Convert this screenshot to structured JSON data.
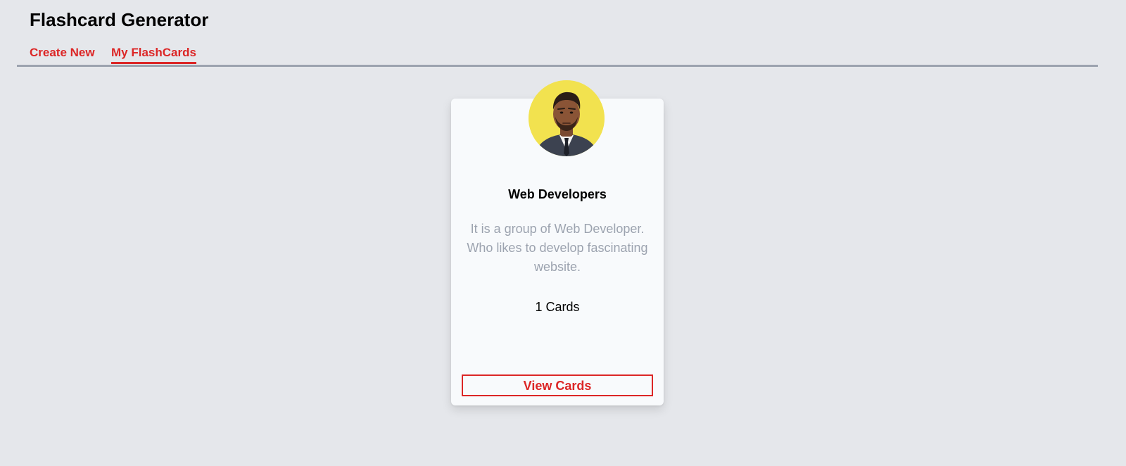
{
  "app": {
    "title": "Flashcard Generator"
  },
  "nav": {
    "tabs": [
      {
        "label": "Create New",
        "active": false
      },
      {
        "label": "My FlashCards",
        "active": true
      }
    ]
  },
  "cards": [
    {
      "avatar_icon": "user-avatar-photo",
      "title": "Web Developers",
      "description": "It is a group of Web Developer. Who likes to develop fascinating website.",
      "count_label": "1 Cards",
      "button_label": "View Cards"
    }
  ],
  "colors": {
    "background": "#e5e7eb",
    "accent": "#dc2626",
    "card_background": "#f8fafc",
    "muted_text": "#9ca3af",
    "avatar_background": "#f2e24f"
  }
}
